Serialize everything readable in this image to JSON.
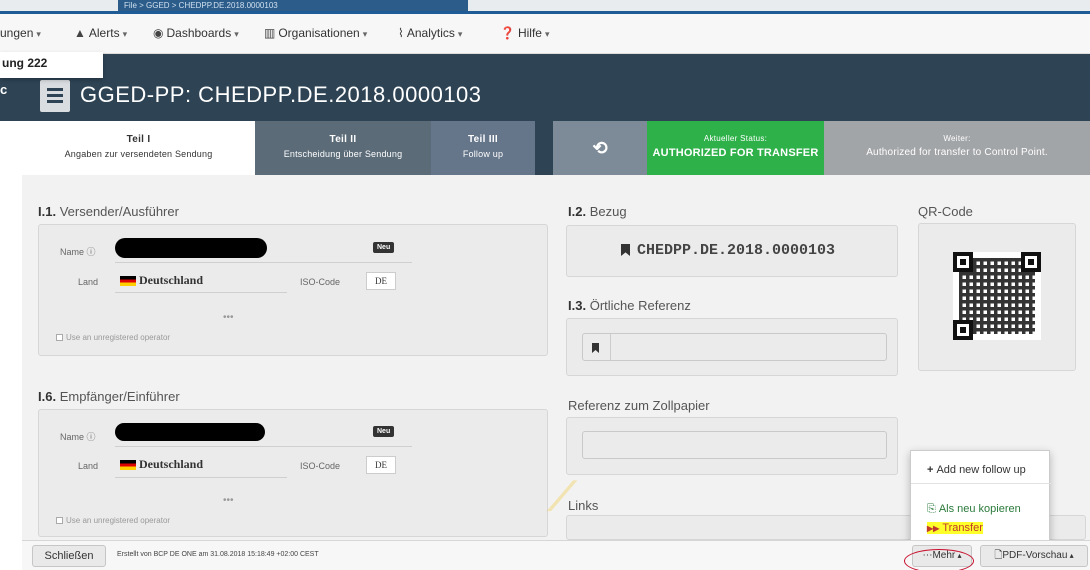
{
  "breadcrumb": "File > GGED > CHEDPP.DE.2018.0000103",
  "nav": {
    "items": [
      {
        "label": "ungen",
        "icon": ""
      },
      {
        "label": "Alerts",
        "icon": "▲"
      },
      {
        "label": "Dashboards",
        "icon": "◉"
      },
      {
        "label": "Organisationen",
        "icon": "▥"
      },
      {
        "label": "Analytics",
        "icon": "⌇"
      },
      {
        "label": "Hilfe",
        "icon": "❓"
      }
    ],
    "dropdown_fragment": "ung 222"
  },
  "header": {
    "left_mark": "c",
    "title": "GGED-PP: CHEDPP.DE.2018.0000103"
  },
  "tabs": [
    {
      "line1": "Teil I",
      "line2": "Angaben zur versendeten Sendung"
    },
    {
      "line1": "Teil II",
      "line2": "Entscheidung über Sendung"
    },
    {
      "line1": "Teil III",
      "line2": "Follow up"
    },
    {
      "icon": "⟲"
    },
    {
      "line1": "Aktueller Status:",
      "line2": "AUTHORIZED FOR TRANSFER"
    },
    {
      "line1": "Weiter:",
      "line2": "Authorized for transfer to Control Point."
    }
  ],
  "consignor": {
    "number": "I.1.",
    "title": "Versender/Ausführer",
    "name_label": "Name ⓘ",
    "badge": "Neu",
    "land_label": "Land",
    "country": "Deutschland",
    "iso_label": "ISO-Code",
    "iso": "DE",
    "dots": "•••",
    "unregistered": "Use an unregistered operator"
  },
  "consignee": {
    "number": "I.6.",
    "title": "Empfänger/Einführer",
    "name_label": "Name ⓘ",
    "badge": "Neu",
    "land_label": "Land",
    "country": "Deutschland",
    "iso_label": "ISO-Code",
    "iso": "DE",
    "dots": "•••",
    "unregistered": "Use an unregistered operator"
  },
  "reference": {
    "number": "I.2.",
    "title": "Bezug",
    "value": "CHEDPP.DE.2018.0000103"
  },
  "local_ref": {
    "number": "I.3.",
    "title": "Örtliche Referenz",
    "value": ""
  },
  "customs_ref": {
    "title": "Referenz zum Zollpapier",
    "value": ""
  },
  "links": {
    "title": "Links"
  },
  "qr": {
    "title": "QR-Code"
  },
  "menu": {
    "items": [
      {
        "icon": "+",
        "label": "Add new follow up"
      },
      {
        "icon": "⎘",
        "label": "Als neu kopieren"
      },
      {
        "icon": "▶▶",
        "label": "Transfer"
      }
    ]
  },
  "footer": {
    "close_label": "Schließen",
    "meta": "Erstellt von BCP DE ONE am 31.08.2018 15:18:49 +02:00 CEST",
    "more_label": "Mehr",
    "pdf_label": "PDF-Vorschau"
  },
  "colors": {
    "header_bg": "#2e4455",
    "status_green": "#2fb14a",
    "highlight": "#ffff2a",
    "annotation_red": "#c8102e"
  }
}
